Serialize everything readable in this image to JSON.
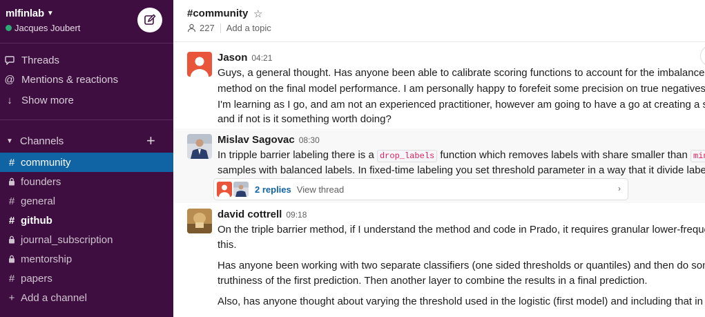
{
  "workspace": {
    "name": "mlfinlab",
    "user": "Jacques Joubert"
  },
  "sidebar": {
    "nav": [
      {
        "label": "Threads",
        "icon": "threads-icon"
      },
      {
        "label": "Mentions & reactions",
        "icon": "at-icon"
      },
      {
        "label": "Show more",
        "icon": "arrow-down-icon"
      }
    ],
    "channels_header": "Channels",
    "channels": [
      {
        "name": "community",
        "private": false,
        "active": true,
        "unread": false
      },
      {
        "name": "founders",
        "private": true,
        "active": false,
        "unread": false
      },
      {
        "name": "general",
        "private": false,
        "active": false,
        "unread": false
      },
      {
        "name": "github",
        "private": false,
        "active": false,
        "unread": true
      },
      {
        "name": "journal_subscription",
        "private": true,
        "active": false,
        "unread": false
      },
      {
        "name": "mentorship",
        "private": true,
        "active": false,
        "unread": false
      },
      {
        "name": "papers",
        "private": false,
        "active": false,
        "unread": false
      }
    ],
    "add_channel": "Add a channel"
  },
  "channel": {
    "title": "#community",
    "members": "227",
    "topic_placeholder": "Add a topic"
  },
  "messages": [
    {
      "author": "Jason",
      "time": "04:21",
      "lines": [
        "Guys, a general thought. Has anyone been able to calibrate scoring functions to account for the imbalanced",
        "method on the final model performance. I am personally happy to forefeit some precision on true negatives f",
        "I'm learning as I go, and am not an experienced practitioner, however am going to have a go at creating a sub",
        "and if not is it something worth doing?"
      ]
    },
    {
      "author": "Mislav Sagovac",
      "time": "08:30",
      "line1_a": "In tripple barrier labeling there is a ",
      "code1": "drop_labels",
      "line1_b": " function which removes labels with share smaller than ",
      "code2": "min_",
      "line2": "samples with balanced labels. In fixed-time labeling you set threshold parameter in a way that it divide labels",
      "thread": {
        "replies": "2 replies",
        "view": "View thread"
      }
    },
    {
      "author": "david cottrell",
      "time": "09:18",
      "lines": [
        "On the triple barrier method, if I understand the method and code in Prado, it requires granular lower-freque",
        "this.",
        "Has anyone been working with two separate classifiers (one sided thresholds or quantiles) and then do some",
        "truthiness of the first prediction. Then another layer to combine the results in a final prediction.",
        "Also, has anyone thought about varying the threshold used in the logistic (first model) and including that in t"
      ]
    }
  ],
  "colors": {
    "sidebar_bg": "#3f0e40",
    "active_channel": "#1164a3",
    "link": "#1264a3",
    "code": "#e01e5a"
  }
}
